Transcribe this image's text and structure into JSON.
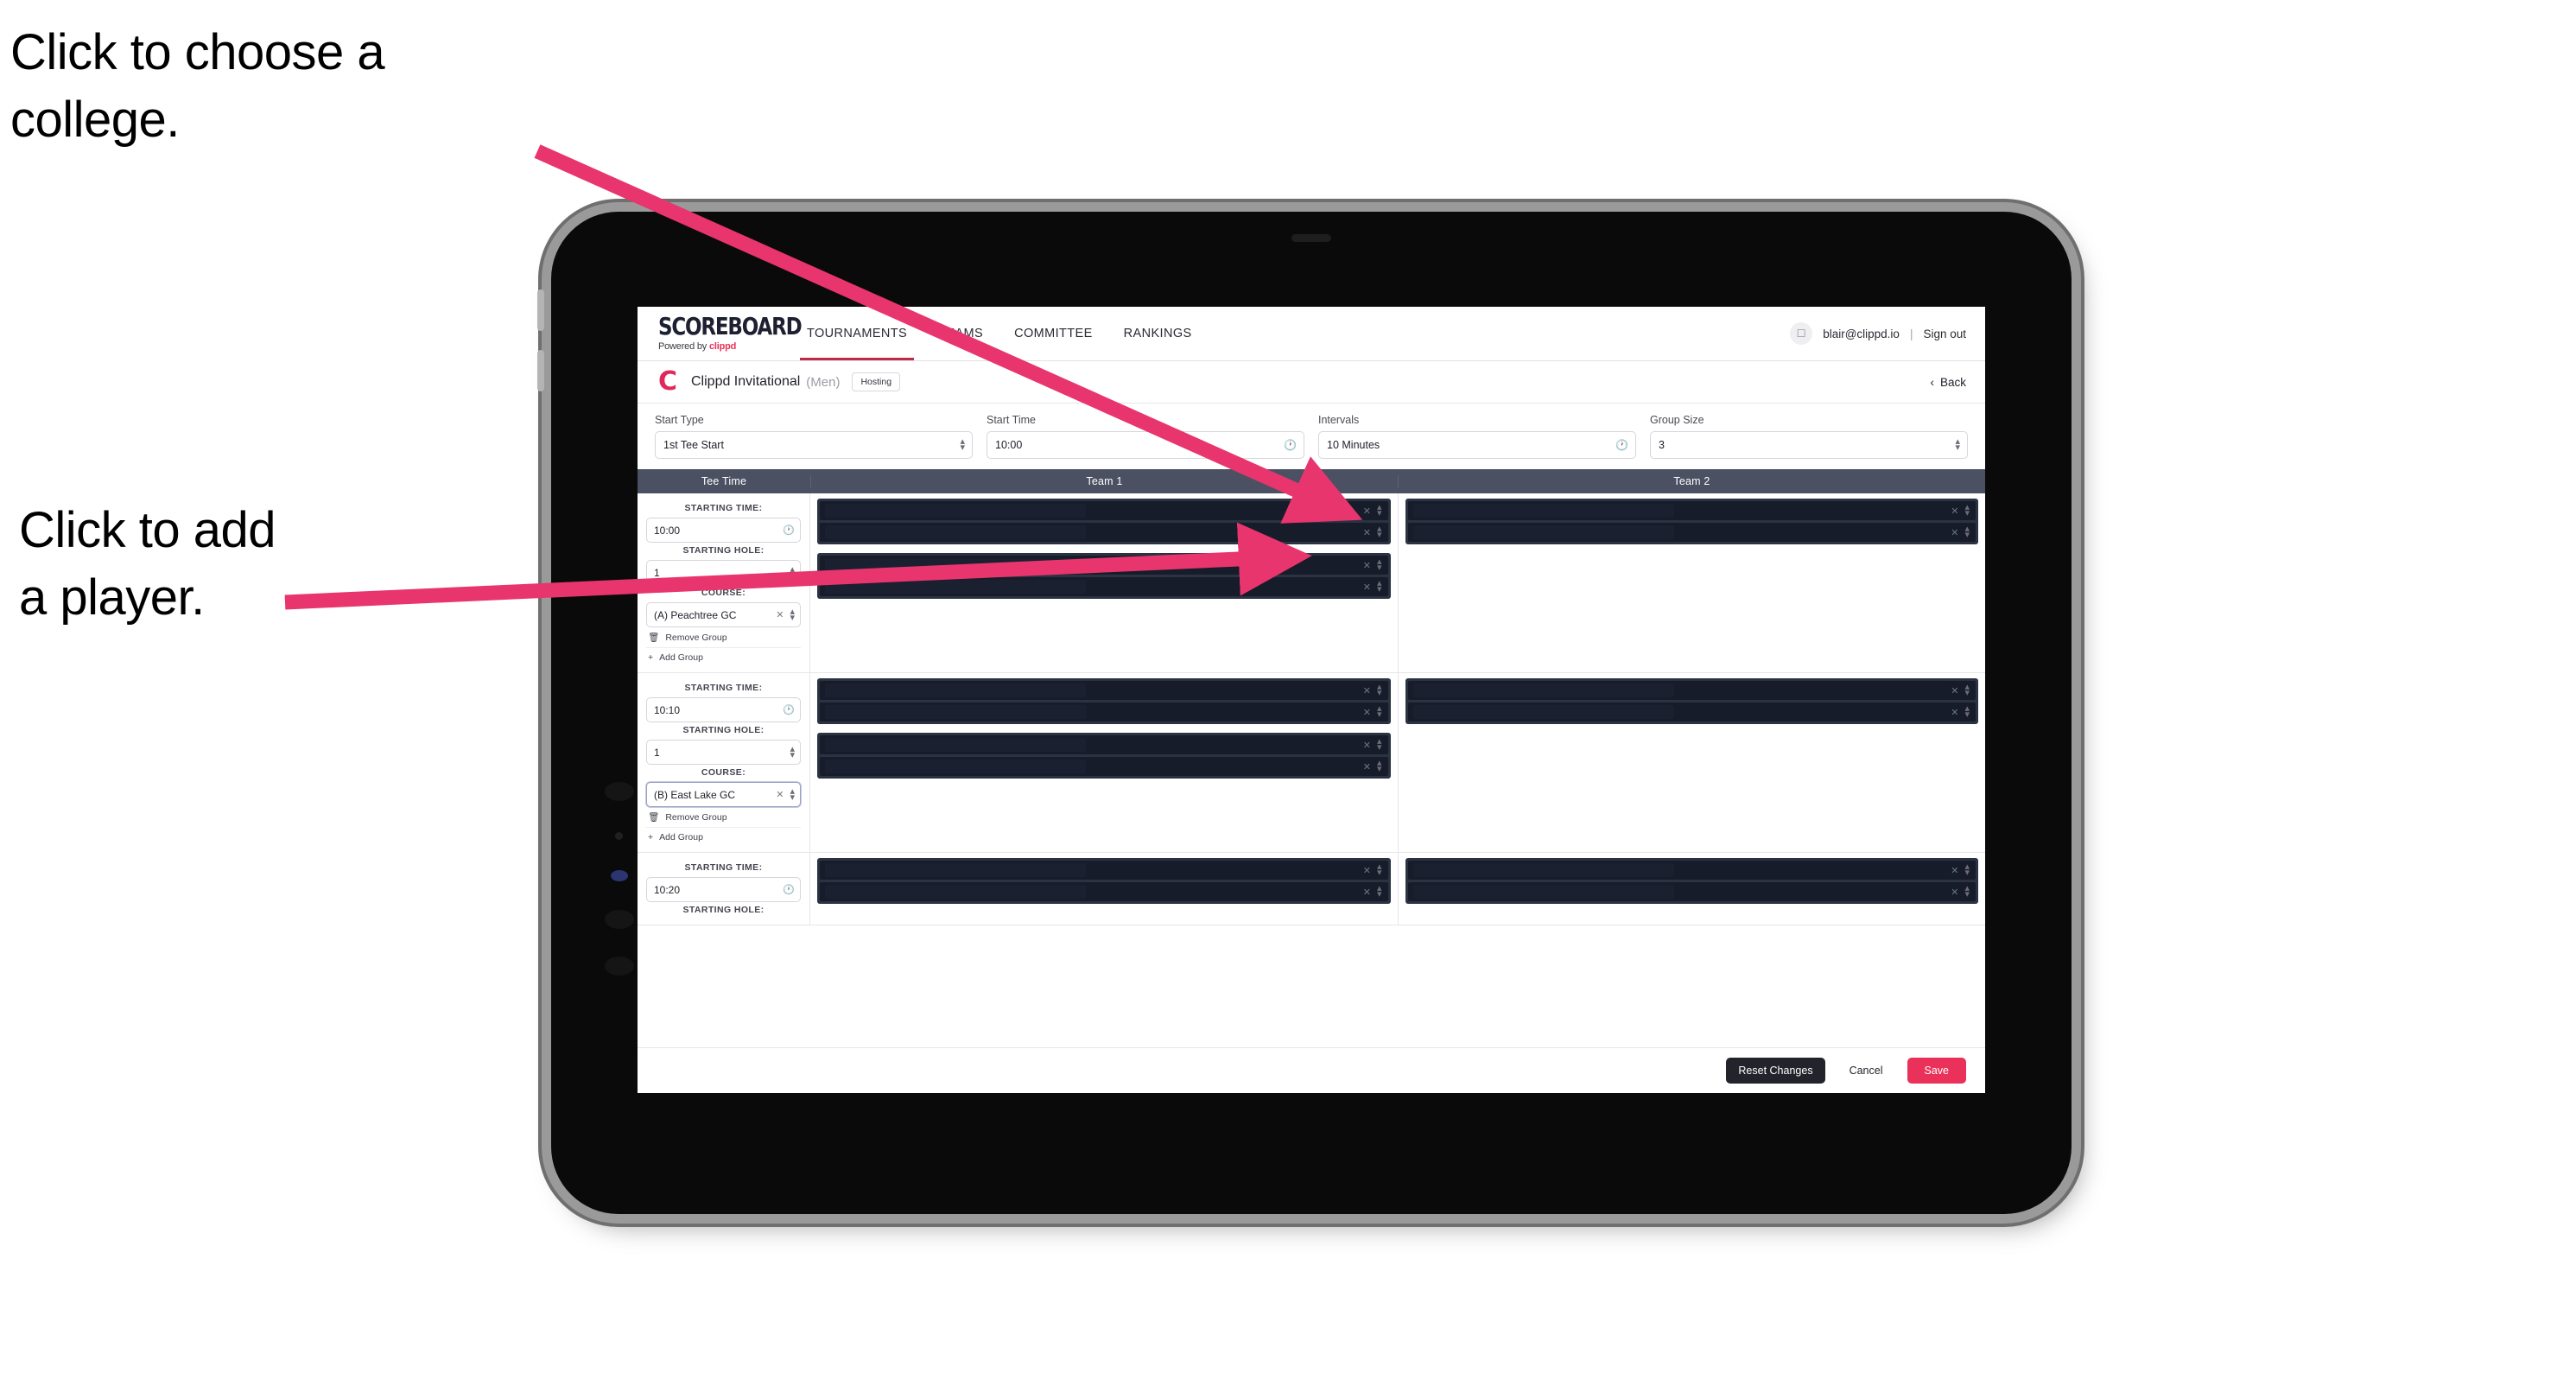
{
  "annotations": {
    "choose_college": "Click to choose a\ncollege.",
    "add_player": "Click to add\na player.",
    "arrow_color": "#e8356d"
  },
  "app": {
    "brand": {
      "name": "SCOREBOARD",
      "sub_prefix": "Powered by ",
      "sub_brand": "clippd"
    },
    "nav": [
      {
        "label": "TOURNAMENTS",
        "active": true
      },
      {
        "label": "TEAMS",
        "active": false
      },
      {
        "label": "COMMITTEE",
        "active": false
      },
      {
        "label": "RANKINGS",
        "active": false
      }
    ],
    "account": {
      "avatar_icon": "user-icon",
      "email": "blair@clippd.io",
      "separator": "|",
      "sign_out": "Sign out"
    },
    "tournament": {
      "logo_letter": "C",
      "name": "Clippd Invitational",
      "gender": "(Men)",
      "status_badge": "Hosting",
      "back_label": "Back",
      "back_icon": "chevron-left-icon"
    },
    "controls": [
      {
        "label": "Start Type",
        "value": "1st Tee Start",
        "adorn": "stepper-icon"
      },
      {
        "label": "Start Time",
        "value": "10:00",
        "adorn": "clock-icon"
      },
      {
        "label": "Intervals",
        "value": "10 Minutes",
        "adorn": "clock-icon"
      },
      {
        "label": "Group Size",
        "value": "3",
        "adorn": "stepper-icon"
      }
    ],
    "table": {
      "headers": {
        "tee_time": "Tee Time",
        "team1": "Team 1",
        "team2": "Team 2"
      },
      "field_labels": {
        "starting_time": "STARTING TIME:",
        "starting_hole": "STARTING HOLE:",
        "course": "COURSE:"
      },
      "group_actions": {
        "remove": "Remove Group",
        "add": "Add Group",
        "remove_icon": "trash-icon",
        "add_icon": "plus-icon"
      },
      "rows": [
        {
          "starting_time": "10:00",
          "starting_hole": "1",
          "course": "(A) Peachtree GC",
          "course_focus": false,
          "team1_groups": [
            {
              "slots": 2
            },
            {
              "slots": 2
            }
          ],
          "team2_groups": [
            {
              "slots": 2
            }
          ]
        },
        {
          "starting_time": "10:10",
          "starting_hole": "1",
          "course": "(B) East Lake GC",
          "course_focus": true,
          "team1_groups": [
            {
              "slots": 2
            },
            {
              "slots": 2
            }
          ],
          "team2_groups": [
            {
              "slots": 2
            }
          ]
        },
        {
          "starting_time": "10:20",
          "starting_hole": "",
          "course": "",
          "course_focus": false,
          "team1_groups": [
            {
              "slots": 2
            }
          ],
          "team2_groups": [
            {
              "slots": 2
            }
          ],
          "clipped": true
        }
      ]
    },
    "footer": {
      "reset": "Reset Changes",
      "cancel": "Cancel",
      "save": "Save"
    }
  },
  "theme": {
    "accent_pink": "#ea3159",
    "header_slate": "#4b5162",
    "slot_dark": "#161c29",
    "slot_group": "#2b3242"
  }
}
